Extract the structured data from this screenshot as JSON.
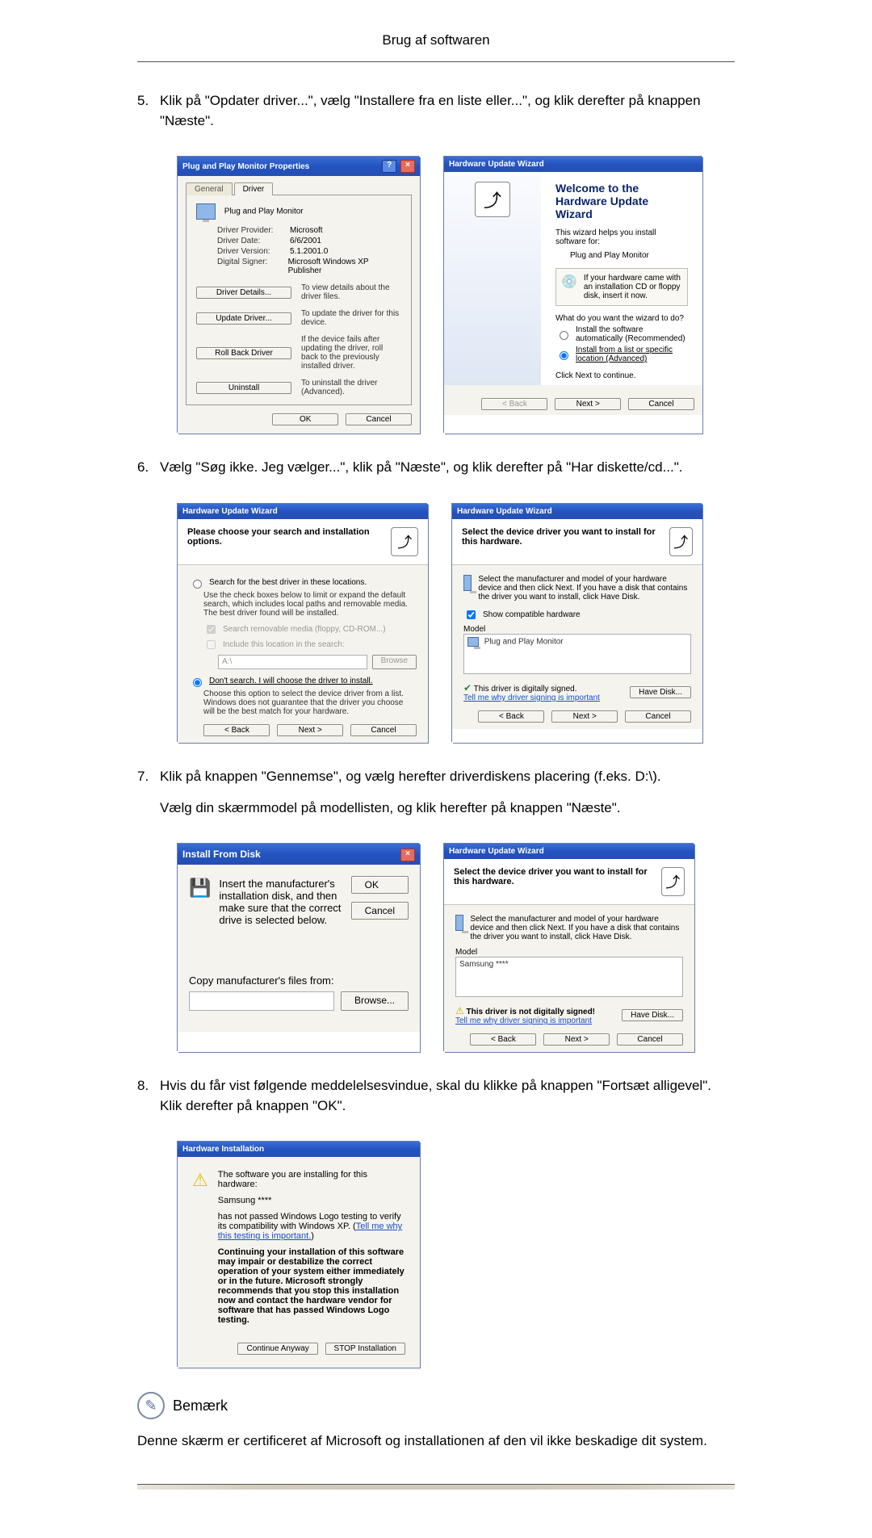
{
  "header": "Brug af softwaren",
  "step5": {
    "num": "5.",
    "text": "Klik på \"Opdater driver...\", vælg \"Installere fra en liste eller...\", og klik derefter på knappen \"Næste\"."
  },
  "props": {
    "title": "Plug and Play Monitor Properties",
    "tab_general": "General",
    "tab_driver": "Driver",
    "device_name": "Plug and Play Monitor",
    "provider_k": "Driver Provider:",
    "provider_v": "Microsoft",
    "date_k": "Driver Date:",
    "date_v": "6/6/2001",
    "version_k": "Driver Version:",
    "version_v": "5.1.2001.0",
    "signer_k": "Digital Signer:",
    "signer_v": "Microsoft Windows XP Publisher",
    "btn_details": "Driver Details...",
    "desc_details": "To view details about the driver files.",
    "btn_update": "Update Driver...",
    "desc_update": "To update the driver for this device.",
    "btn_rollback": "Roll Back Driver",
    "desc_rollback": "If the device fails after updating the driver, roll back to the previously installed driver.",
    "btn_uninstall": "Uninstall",
    "desc_uninstall": "To uninstall the driver (Advanced).",
    "ok": "OK",
    "cancel": "Cancel"
  },
  "wiz1": {
    "title": "Hardware Update Wizard",
    "welcome": "Welcome to the Hardware Update Wizard",
    "helps": "This wizard helps you install software for:",
    "device": "Plug and Play Monitor",
    "info": "If your hardware came with an installation CD or floppy disk, insert it now.",
    "prompt": "What do you want the wizard to do?",
    "opt_auto": "Install the software automatically (Recommended)",
    "opt_list": "Install from a list or specific location (Advanced)",
    "cont": "Click Next to continue.",
    "back": "< Back",
    "next": "Next >",
    "cancel": "Cancel"
  },
  "step6": {
    "num": "6.",
    "text": "Vælg \"Søg ikke. Jeg vælger...\", klik på \"Næste\", og klik derefter på \"Har diskette/cd...\"."
  },
  "wiz2": {
    "title": "Hardware Update Wizard",
    "head": "Please choose your search and installation options.",
    "opt_search": "Search for the best driver in these locations.",
    "search_desc": "Use the check boxes below to limit or expand the default search, which includes local paths and removable media. The best driver found will be installed.",
    "cb_removable": "Search removable media (floppy, CD-ROM...)",
    "cb_include": "Include this location in the search:",
    "path": "A:\\",
    "browse": "Browse",
    "opt_dont": "Don't search. I will choose the driver to install.",
    "dont_desc": "Choose this option to select the device driver from a list. Windows does not guarantee that the driver you choose will be the best match for your hardware.",
    "back": "< Back",
    "next": "Next >",
    "cancel": "Cancel"
  },
  "wiz3": {
    "title": "Hardware Update Wizard",
    "head": "Select the device driver you want to install for this hardware.",
    "instr": "Select the manufacturer and model of your hardware device and then click Next. If you have a disk that contains the driver you want to install, click Have Disk.",
    "cb_compat": "Show compatible hardware",
    "model_lbl": "Model",
    "model_item": "Plug and Play Monitor",
    "signed": "This driver is digitally signed.",
    "tell": "Tell me why driver signing is important",
    "havedisk": "Have Disk...",
    "back": "< Back",
    "next": "Next >",
    "cancel": "Cancel"
  },
  "step7": {
    "num": "7.",
    "text1": "Klik på knappen \"Gennemse\", og vælg herefter driverdiskens placering (f.eks. D:\\).",
    "text2": "Vælg din skærmmodel på modellisten, og klik herefter på knappen \"Næste\"."
  },
  "idisk": {
    "title": "Install From Disk",
    "instr": "Insert the manufacturer's installation disk, and then make sure that the correct drive is selected below.",
    "ok": "OK",
    "cancel": "Cancel",
    "copy_lbl": "Copy manufacturer's files from:",
    "browse": "Browse..."
  },
  "wiz4": {
    "title": "Hardware Update Wizard",
    "head": "Select the device driver you want to install for this hardware.",
    "instr": "Select the manufacturer and model of your hardware device and then click Next. If you have a disk that contains the driver you want to install, click Have Disk.",
    "model_lbl": "Model",
    "model_item": "Samsung ****",
    "unsigned": "This driver is not digitally signed!",
    "tell": "Tell me why driver signing is important",
    "havedisk": "Have Disk...",
    "back": "< Back",
    "next": "Next >",
    "cancel": "Cancel"
  },
  "step8": {
    "num": "8.",
    "text": "Hvis du får vist følgende meddelelsesvindue, skal du klikke på knappen \"Fortsæt alligevel\". Klik derefter på knappen \"OK\"."
  },
  "hwinst": {
    "title": "Hardware Installation",
    "line1": "The software you are installing for this hardware:",
    "device": "Samsung ****",
    "line2a": "has not passed Windows Logo testing to verify its compatibility with Windows XP. (",
    "line2link": "Tell me why this testing is important.",
    "line2b": ")",
    "bold": "Continuing your installation of this software may impair or destabilize the correct operation of your system either immediately or in the future. Microsoft strongly recommends that you stop this installation now and contact the hardware vendor for software that has passed Windows Logo testing.",
    "cont": "Continue Anyway",
    "stop": "STOP Installation"
  },
  "note_label": "Bemærk",
  "note_text": "Denne skærm er certificeret af Microsoft og installationen af den vil ikke beskadige dit system."
}
